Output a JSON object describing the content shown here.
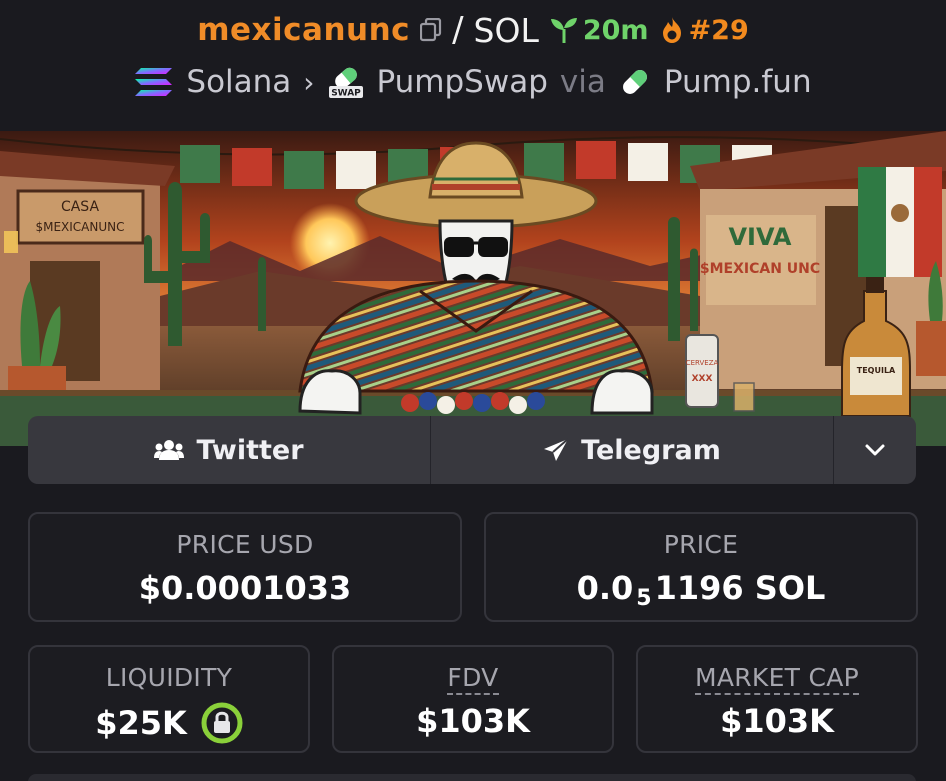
{
  "header": {
    "token_name": "mexicanunc",
    "separator": "/",
    "quote_symbol": "SOL",
    "age": "20m",
    "rank": "#29",
    "chain": "Solana",
    "dex": "PumpSwap",
    "via_label": "via",
    "launchpad": "Pump.fun",
    "swap_badge": "SWAP"
  },
  "banner": {
    "sign_left": [
      "CASA",
      "$MEXICANUNC"
    ],
    "sign_right": [
      "VIVA",
      "$MEXICAN UNC"
    ],
    "can_label": [
      "CERVEZA",
      "XXX"
    ],
    "bottle_label": "TEQUILA"
  },
  "socials": {
    "twitter_label": "Twitter",
    "telegram_label": "Telegram"
  },
  "stats": {
    "price_usd_label": "PRICE USD",
    "price_usd_value": "$0.0001033",
    "price_label": "PRICE",
    "price_value_prefix": "0.0",
    "price_value_sub": "5",
    "price_value_suffix": "1196 SOL",
    "liquidity_label": "LIQUIDITY",
    "liquidity_value": "$25K",
    "fdv_label": "FDV",
    "fdv_value": "$103K",
    "mcap_label": "MARKET CAP",
    "mcap_value": "$103K"
  },
  "colors": {
    "accent_orange": "#f08c28",
    "green": "#6fd36a",
    "background": "#1a1a1f"
  },
  "icons": [
    "copy-icon",
    "sprout-icon",
    "flame-icon",
    "solana-icon",
    "chevron-right-icon",
    "pumpswap-icon",
    "pill-icon",
    "users-icon",
    "send-icon",
    "chevron-down-icon",
    "lock-icon"
  ]
}
